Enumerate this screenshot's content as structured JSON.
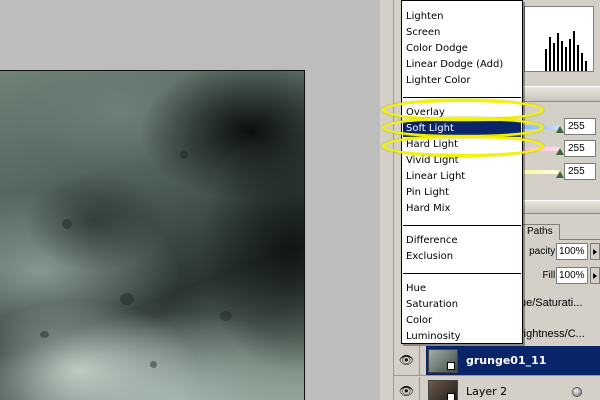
{
  "blend_menu": {
    "groups": [
      [
        "Lighten",
        "Screen",
        "Color Dodge",
        "Linear Dodge (Add)",
        "Lighter Color"
      ],
      [
        "Overlay",
        "Soft Light",
        "Hard Light",
        "Vivid Light",
        "Linear Light",
        "Pin Light",
        "Hard Mix"
      ],
      [
        "Difference",
        "Exclusion"
      ],
      [
        "Hue",
        "Saturation",
        "Color",
        "Luminosity"
      ]
    ],
    "highlighted": "Soft Light",
    "circled": [
      "Overlay",
      "Soft Light",
      "Hard Light"
    ]
  },
  "levels": {
    "values": [
      "255",
      "255",
      "255"
    ]
  },
  "layers_panel": {
    "tab_label": "Paths",
    "opacity_label": "pacity:",
    "opacity_value": "100%",
    "fill_label": "Fill:",
    "fill_value": "100%",
    "partial_rows": [
      "ue/Saturati...",
      "rightness/C..."
    ],
    "layers": [
      {
        "name": "grunge01_11",
        "selected": true
      },
      {
        "name": "Layer 2",
        "selected": false
      }
    ]
  },
  "colors": {
    "menu_highlight": "#0a246a",
    "annotation": "#f3f300",
    "panel_bg": "#d4d0c8",
    "workspace_bg": "#bdbdbd"
  },
  "icons": [
    "eye-icon",
    "layer-mask-icon",
    "layer-style-icon",
    "slider-thumb-icon",
    "dropdown-arrow-icon"
  ]
}
